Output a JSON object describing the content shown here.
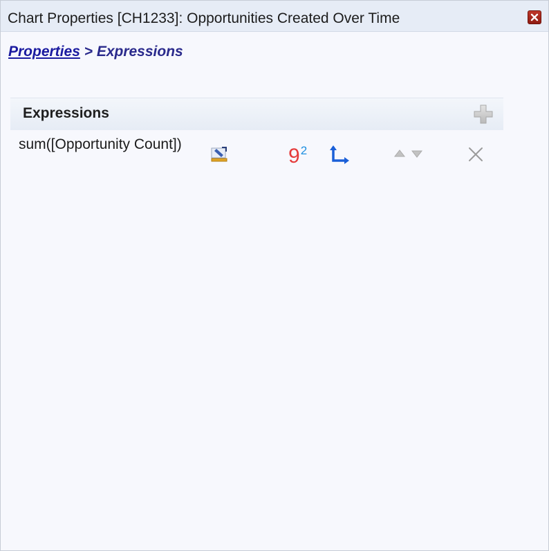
{
  "window": {
    "title": "Chart Properties [CH1233]: Opportunities Created Over Time"
  },
  "breadcrumb": {
    "link": "Properties",
    "separator": " > ",
    "current": "Expressions"
  },
  "panel": {
    "title": "Expressions",
    "add_icon": "plus-icon"
  },
  "expressions": [
    {
      "text": "sum([Opportunity Count])",
      "format_label": "9",
      "format_sup": "2",
      "icons": [
        "edit-icon",
        "number-format-icon",
        "axis-icon",
        "move-up-icon",
        "move-down-icon",
        "delete-icon"
      ]
    }
  ],
  "colors": {
    "title_bar": "#e6ecf6",
    "background": "#f7f8fd",
    "breadcrumb": "#2a2a8c",
    "close_button": "#c0392b",
    "format_red": "#e53b3b",
    "format_blue": "#1e8fe0",
    "axis_blue": "#1a5fd8"
  }
}
